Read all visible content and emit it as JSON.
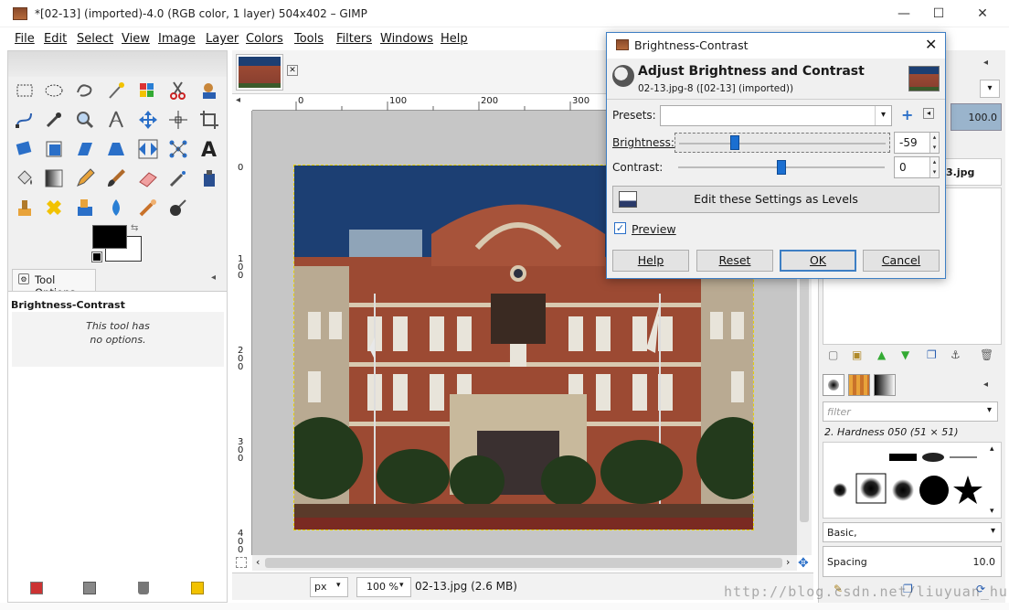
{
  "window": {
    "title": "*[02-13] (imported)-4.0 (RGB color, 1 layer) 504x402 – GIMP",
    "minimize": "—",
    "maximize": "☐",
    "close": "✕"
  },
  "menubar": [
    "File",
    "Edit",
    "Select",
    "View",
    "Image",
    "Layer",
    "Colors",
    "Tools",
    "Filters",
    "Windows",
    "Help"
  ],
  "toolbox": {
    "tool_options_tab": "Tool Options",
    "tool_name": "Brightness-Contrast",
    "no_options_line1": "This tool has",
    "no_options_line2": "no options."
  },
  "rulers": {
    "h_ticks": [
      "0",
      "100",
      "200",
      "300"
    ],
    "v_ticks": [
      "0",
      "100",
      "200",
      "300",
      "400"
    ]
  },
  "statusbar": {
    "unit": "px",
    "zoom": "100 %",
    "file_info": "02-13.jpg (2.6 MB)"
  },
  "dialog": {
    "title": "Brightness-Contrast",
    "heading": "Adjust Brightness and Contrast",
    "subheading": "02-13.jpg-8 ([02-13] (imported))",
    "presets_label": "Presets:",
    "presets_value": "",
    "brightness_label": "Brightness:",
    "brightness_value": "-59",
    "brightness_level": -59,
    "contrast_label": "Contrast:",
    "contrast_value": "0",
    "contrast_level": 0,
    "levels_button": "Edit these Settings as Levels",
    "preview_label": "Preview",
    "preview_checked": true,
    "buttons": {
      "help": "Help",
      "reset": "Reset",
      "ok": "OK",
      "cancel": "Cancel"
    }
  },
  "dock": {
    "opacity_value": "100.0",
    "layer_name_partial": "3.jpg",
    "brush_filter_placeholder": "filter",
    "brush_name": "2. Hardness 050 (51 × 51)",
    "brush_preset": "Basic,",
    "spacing_label": "Spacing",
    "spacing_value": "10.0"
  },
  "watermark": "http://blog.csdn.net/liuyuan_hu",
  "colors": {
    "accent": "#3e7fc4",
    "brick": "#9c4a33",
    "sky": "#1c3f73",
    "slider_handle": "#1b6fd1"
  }
}
